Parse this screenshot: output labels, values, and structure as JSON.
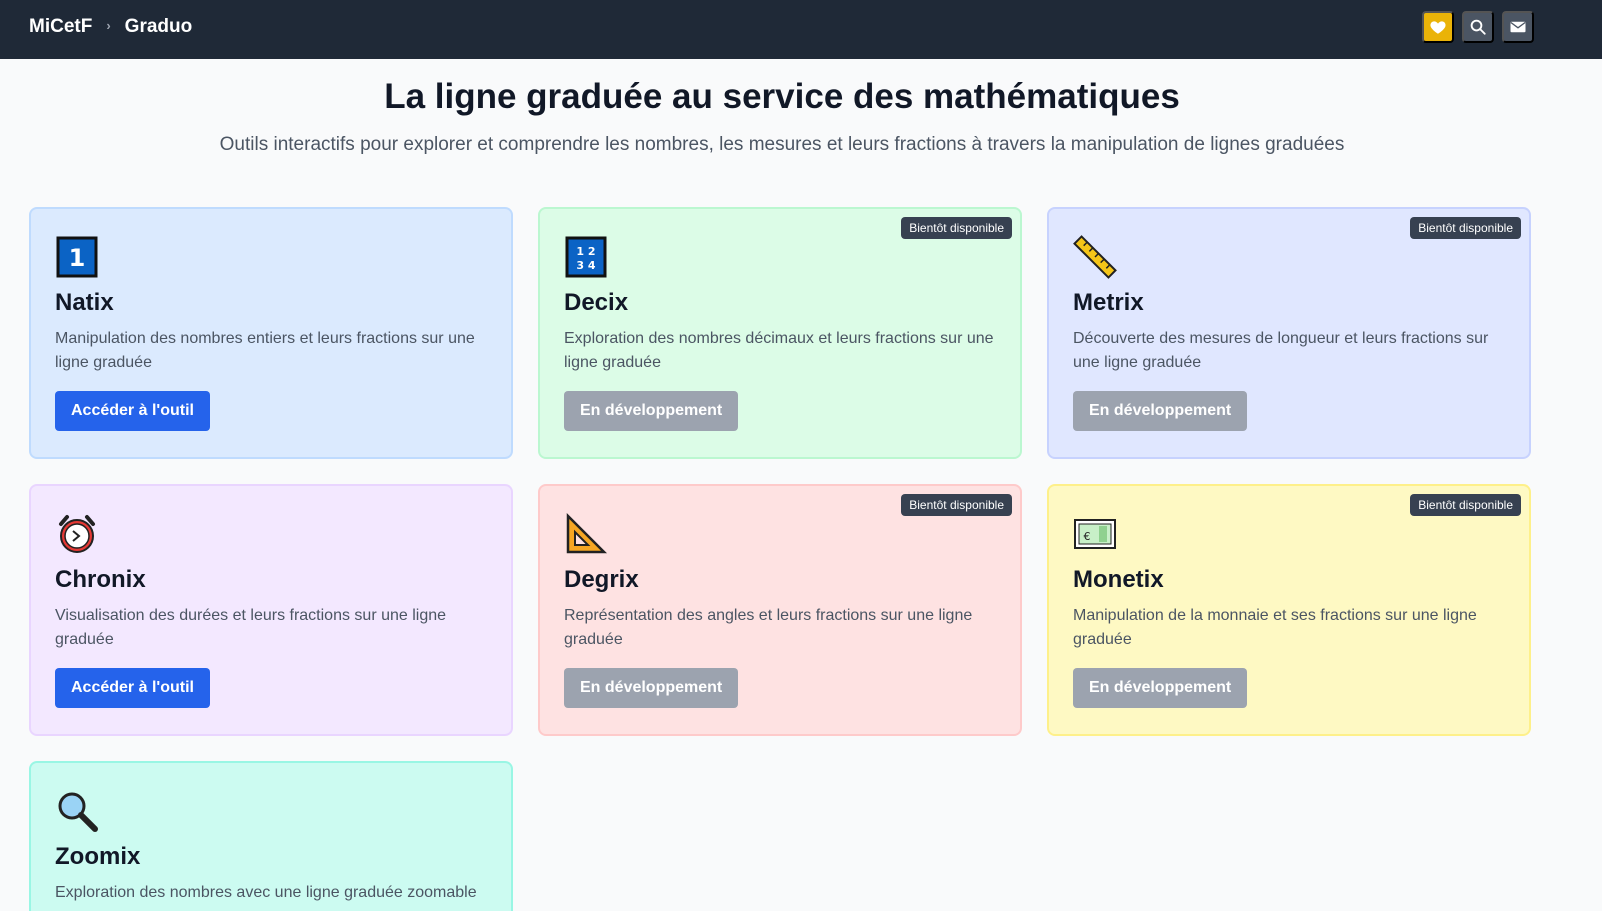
{
  "nav": {
    "brand": "MiCetF",
    "separator": "›",
    "section": "Graduo",
    "actions": [
      {
        "name": "favorite",
        "icon": "heart-icon",
        "color": "#eab308"
      },
      {
        "name": "search",
        "icon": "search-icon",
        "color": "#4b5563"
      },
      {
        "name": "contact",
        "icon": "mail-icon",
        "color": "#4b5563"
      }
    ]
  },
  "hero": {
    "title": "La ligne graduée au service des mathématiques",
    "subtitle": "Outils interactifs pour explorer et comprendre les nombres, les mesures et leurs fractions à travers la manipulation de lignes graduées"
  },
  "cards": [
    {
      "title": "Natix",
      "description": "Manipulation des nombres entiers et leurs fractions sur une ligne graduée",
      "button": "Accéder à l'outil",
      "status": "active",
      "badge": "",
      "icon": "number-one-icon"
    },
    {
      "title": "Decix",
      "description": "Exploration des nombres décimaux et leurs fractions sur une ligne graduée",
      "button": "En développement",
      "status": "disabled",
      "badge": "Bientôt disponible",
      "icon": "numbers-grid-icon"
    },
    {
      "title": "Metrix",
      "description": "Découverte des mesures de longueur et leurs fractions sur une ligne graduée",
      "button": "En développement",
      "status": "disabled",
      "badge": "Bientôt disponible",
      "icon": "ruler-icon"
    },
    {
      "title": "Chronix",
      "description": "Visualisation des durées et leurs fractions sur une ligne graduée",
      "button": "Accéder à l'outil",
      "status": "active",
      "badge": "",
      "icon": "alarm-clock-icon"
    },
    {
      "title": "Degrix",
      "description": "Représentation des angles et leurs fractions sur une ligne graduée",
      "button": "En développement",
      "status": "disabled",
      "badge": "Bientôt disponible",
      "icon": "set-square-icon"
    },
    {
      "title": "Monetix",
      "description": "Manipulation de la monnaie et ses fractions sur une ligne graduée",
      "button": "En développement",
      "status": "disabled",
      "badge": "Bientôt disponible",
      "icon": "euro-banknote-icon"
    },
    {
      "title": "Zoomix",
      "description": "Exploration des nombres avec une ligne graduée zoomable",
      "button": "",
      "status": "",
      "badge": "",
      "icon": "magnifier-icon"
    }
  ],
  "colors": {
    "navbar": "#1f2937",
    "primary_button": "#2563eb",
    "disabled_button": "#9ca3af",
    "badge": "#374151"
  }
}
